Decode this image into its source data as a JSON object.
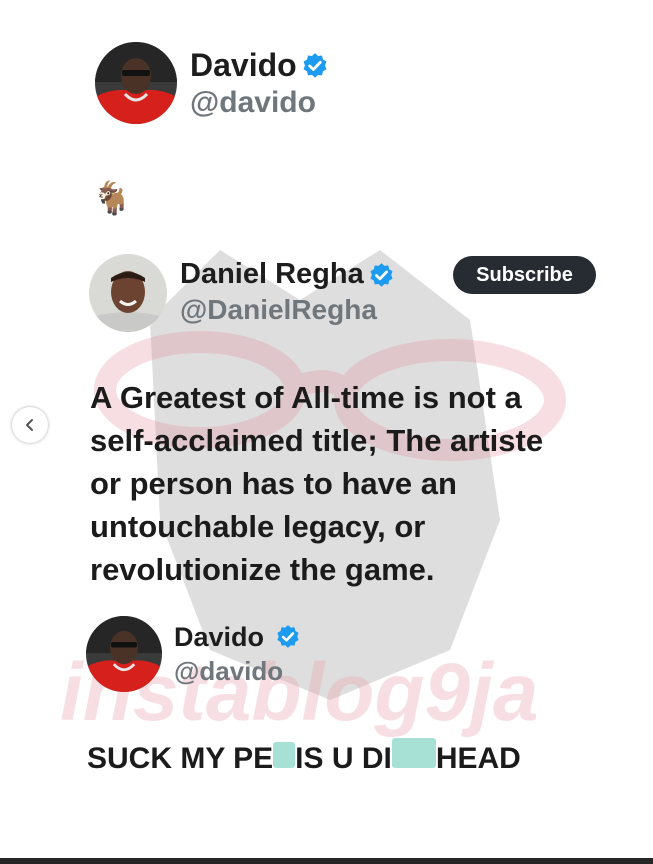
{
  "tweet1": {
    "name": "Davido",
    "handle": "@davido",
    "emoji": "🐐"
  },
  "quoted": {
    "name": "Daniel Regha",
    "handle": "@DanielRegha",
    "subscribe_label": "Subscribe",
    "text_lines": [
      "A Greatest of All-time is not a",
      "self-acclaimed title; The artiste",
      "or person has to have an",
      "untouchable legacy, or",
      "revolutionize the game."
    ]
  },
  "tweet2": {
    "name": "Davido",
    "handle": "@davido",
    "reply_parts": [
      "SUCK MY PE",
      "IS U DI",
      "HEAD"
    ]
  },
  "watermark": {
    "text": "instablog9ja"
  },
  "colors": {
    "verified": "#1d9bf0",
    "subscribe_bg": "#262c31",
    "handle": "#6f767c",
    "censor_blur": "#a7e0d4",
    "watermark_pink": "#e9a3ad"
  }
}
